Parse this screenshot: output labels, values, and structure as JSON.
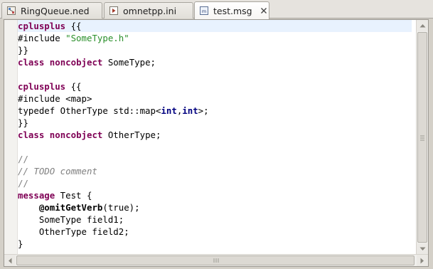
{
  "tabs": [
    {
      "label": "RingQueue.ned",
      "icon": "ned-file-icon",
      "active": false
    },
    {
      "label": "omnetpp.ini",
      "icon": "ini-file-icon",
      "active": false
    },
    {
      "label": "test.msg",
      "icon": "msg-file-icon",
      "active": true,
      "close_icon": "close-icon"
    }
  ],
  "code_lines": [
    [
      {
        "t": "cplusplus",
        "c": "kw"
      },
      {
        "t": " {{"
      }
    ],
    [
      {
        "t": "#include "
      },
      {
        "t": "\"SomeType.h\"",
        "c": "str"
      }
    ],
    [
      {
        "t": "}}"
      }
    ],
    [
      {
        "t": "class",
        "c": "kw"
      },
      {
        "t": " "
      },
      {
        "t": "noncobject",
        "c": "kw"
      },
      {
        "t": " SomeType;"
      }
    ],
    [],
    [
      {
        "t": "cplusplus",
        "c": "kw"
      },
      {
        "t": " {{"
      }
    ],
    [
      {
        "t": "#include <map>"
      }
    ],
    [
      {
        "t": "typedef OtherType std::map<"
      },
      {
        "t": "int",
        "c": "typ"
      },
      {
        "t": ","
      },
      {
        "t": "int",
        "c": "typ"
      },
      {
        "t": ">;"
      }
    ],
    [
      {
        "t": "}}"
      }
    ],
    [
      {
        "t": "class",
        "c": "kw"
      },
      {
        "t": " "
      },
      {
        "t": "noncobject",
        "c": "kw"
      },
      {
        "t": " OtherType;"
      }
    ],
    [],
    [
      {
        "t": "//",
        "c": "cmt"
      }
    ],
    [
      {
        "t": "// TODO comment",
        "c": "cmt it"
      }
    ],
    [
      {
        "t": "//",
        "c": "cmt"
      }
    ],
    [
      {
        "t": "message",
        "c": "kw"
      },
      {
        "t": " Test {"
      }
    ],
    [
      {
        "t": "    "
      },
      {
        "t": "@omitGetVerb",
        "c": "prop"
      },
      {
        "t": "(true);"
      }
    ],
    [
      {
        "t": "    SomeType field1;"
      }
    ],
    [
      {
        "t": "    OtherType field2;"
      }
    ],
    [
      {
        "t": "}"
      }
    ]
  ],
  "current_line": 0,
  "colors": {
    "keyword": "#7f0055",
    "string": "#2a8f2a",
    "comment": "#7f7f7f",
    "type": "#000080",
    "current_line_bg": "#e8f2fe"
  },
  "scrollbars": {
    "vertical": {
      "icons": [
        "scroll-up-arrow-icon",
        "scroll-down-arrow-icon"
      ]
    },
    "horizontal": {
      "icons": [
        "scroll-left-arrow-icon",
        "scroll-right-arrow-icon"
      ]
    }
  }
}
